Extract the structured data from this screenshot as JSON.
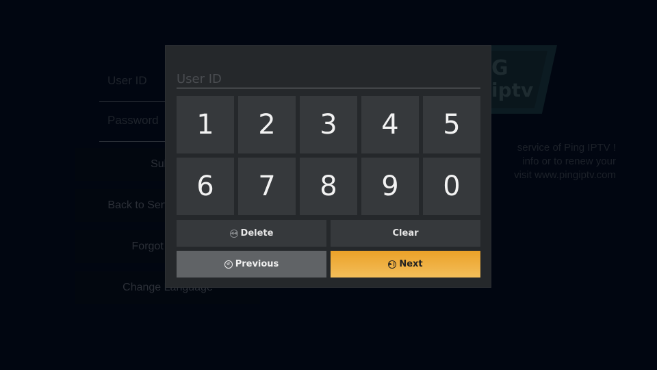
{
  "background": {
    "fields": {
      "userid_placeholder": "User ID",
      "password_placeholder": "Password"
    },
    "buttons": [
      {
        "label": "Submit"
      },
      {
        "label": "Back to Server Selection"
      },
      {
        "label": "Forgot User ID"
      },
      {
        "label": "Change Language"
      }
    ],
    "logo": {
      "line1": "G",
      "line2": "iptv"
    },
    "info_lines": [
      "service of Ping IPTV !",
      "info or to renew your",
      "visit www.pingiptv.com"
    ]
  },
  "keypad": {
    "input": {
      "value": "",
      "placeholder": "User ID"
    },
    "keys": [
      "1",
      "2",
      "3",
      "4",
      "5",
      "6",
      "7",
      "8",
      "9",
      "0"
    ],
    "actions": {
      "delete": {
        "label": "Delete",
        "icon": "rewind-icon"
      },
      "clear": {
        "label": "Clear"
      },
      "previous": {
        "label": "Previous",
        "icon": "back-icon"
      },
      "next": {
        "label": "Next",
        "icon": "play-pause-icon"
      }
    },
    "colors": {
      "accent": "#F0A830",
      "key": "#36393C",
      "modal": "#25282B",
      "focused_secondary": "#606366"
    }
  }
}
